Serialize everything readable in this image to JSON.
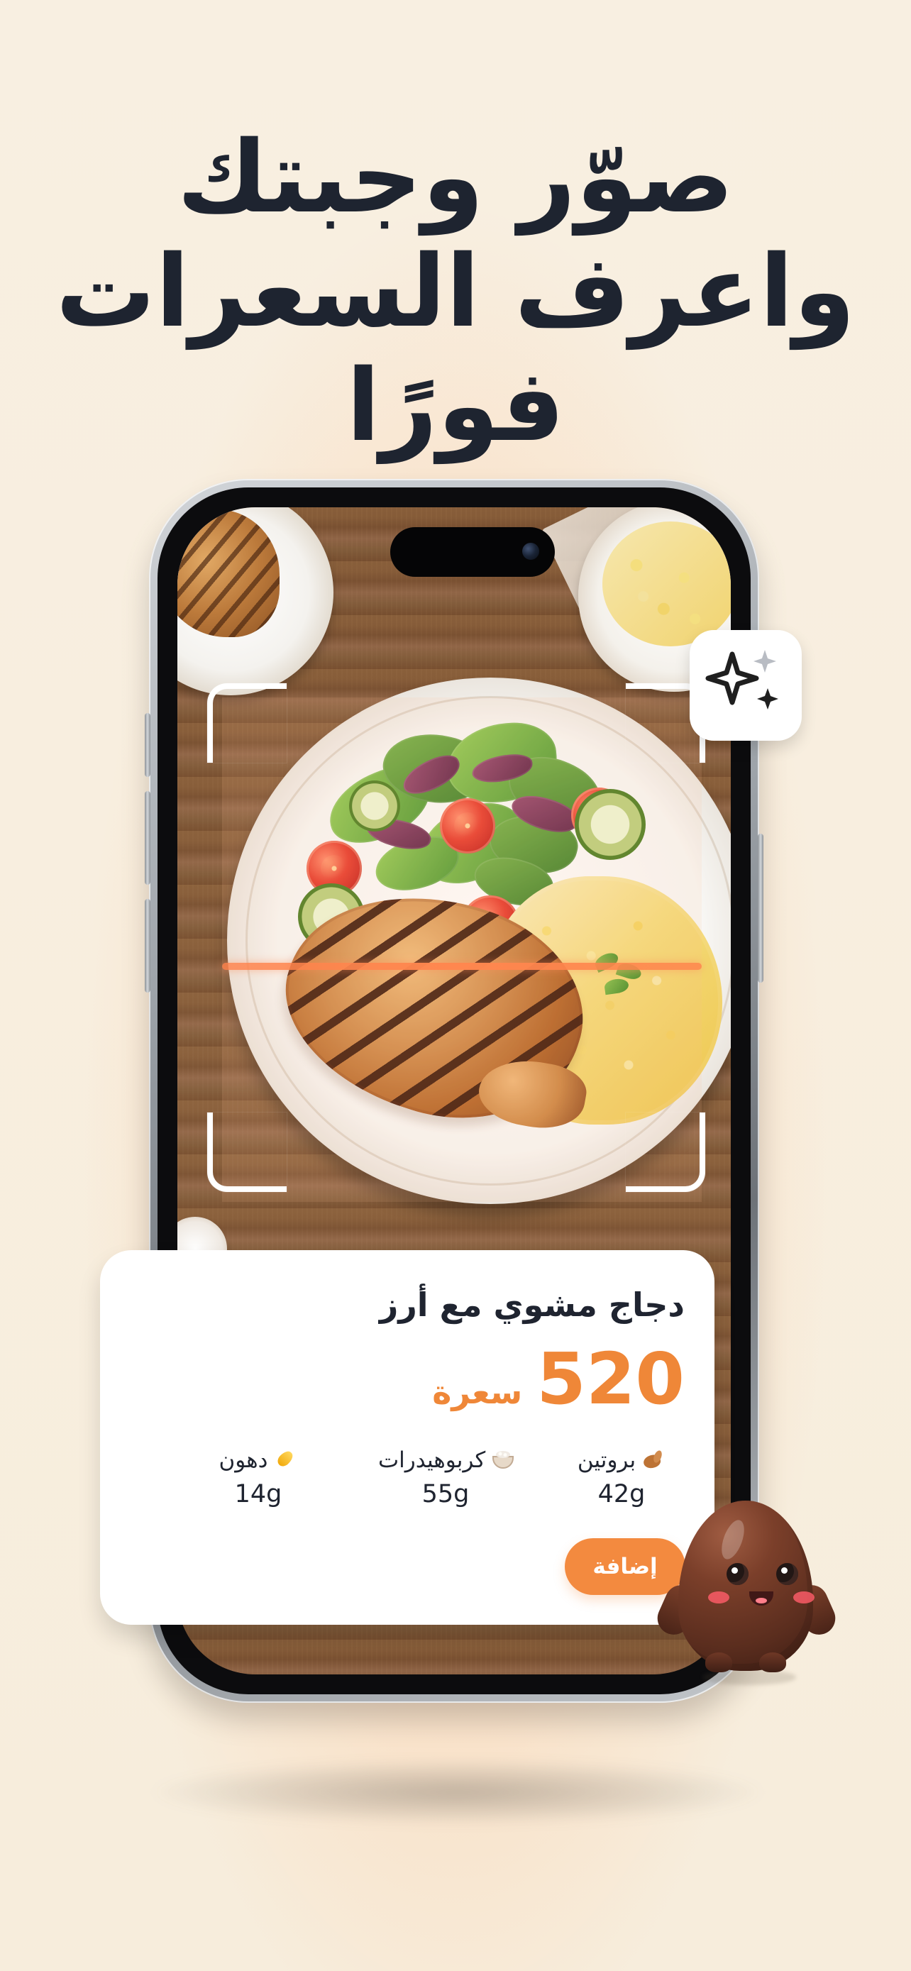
{
  "headline": {
    "line1": "صوّر وجبتك",
    "line2": "واعرف السعرات فورًا"
  },
  "result_card": {
    "dish_name": "دجاج مشوي مع أرز",
    "calories": "520",
    "calorie_unit": "سعرة",
    "macros": [
      {
        "label": "بروتين",
        "value": "42g",
        "icon": "muscle-icon"
      },
      {
        "label": "كربوهيدرات",
        "value": "55g",
        "icon": "rice-bowl-icon"
      },
      {
        "label": "دهون",
        "value": "14g",
        "icon": "oil-drop-icon"
      }
    ],
    "add_button_label": "إضافة"
  },
  "icons": {
    "ai_badge": "sparkles-icon",
    "mascot": "mascot"
  },
  "colors": {
    "background": "#f7eedf",
    "text_primary": "#1f2430",
    "accent": "#ef8738",
    "button": "#f38a3f",
    "card": "#ffffff"
  }
}
